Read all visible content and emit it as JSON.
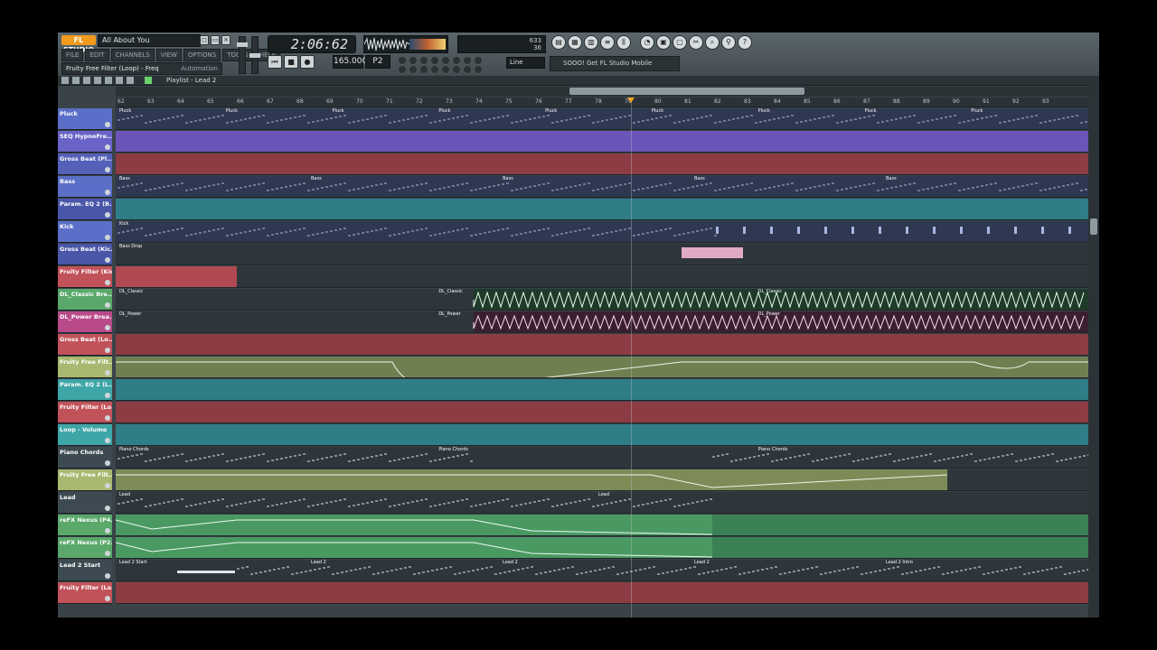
{
  "app": {
    "logo": "FL STUDIO",
    "song_title": "All About You",
    "win_buttons": [
      "◻",
      "▭",
      "×"
    ]
  },
  "menus": [
    "FILE",
    "EDIT",
    "CHANNELS",
    "VIEW",
    "OPTIONS",
    "TOOLS",
    "HELP"
  ],
  "hint": {
    "left": "Fruity Free Filter (Loop) - Freq",
    "right": "Automation"
  },
  "transport": {
    "time": "2:06:62",
    "tempo": "165.000",
    "pattern": "P2",
    "buttons": [
      "⏮",
      "■",
      "●"
    ]
  },
  "cpu": {
    "lines": [
      "633",
      "36"
    ],
    "line_mode": "Line"
  },
  "news": "SOOO! Get FL Studio Mobile",
  "playlist": {
    "title": "Playlist - Lead 2"
  },
  "ruler": [
    "62",
    "63",
    "64",
    "65",
    "66",
    "67",
    "68",
    "69",
    "70",
    "71",
    "72",
    "73",
    "74",
    "75",
    "76",
    "77",
    "78",
    "79",
    "80",
    "81",
    "82",
    "83",
    "84",
    "85",
    "86",
    "87",
    "88",
    "89",
    "90",
    "91",
    "92",
    "93"
  ],
  "tracks": [
    {
      "name": "Pluck",
      "color": "#5a6fc7",
      "lane": "notes",
      "clips": [
        "Pluck",
        "Pluck",
        "Pluck",
        "Pluck",
        "Pluck",
        "Pluck",
        "Pluck",
        "Pluck",
        "Pluck"
      ]
    },
    {
      "name": "SEQ HypnoFre...",
      "color": "#6a63c7",
      "lane": "purple",
      "clips": []
    },
    {
      "name": "Gross Beat (Pl...",
      "color": "#5560b8",
      "lane": "red",
      "clips": []
    },
    {
      "name": "Bass",
      "color": "#5a6fc7",
      "lane": "notes",
      "clips": [
        "Bass",
        "Bass",
        "Bass",
        "Bass",
        "Bass"
      ]
    },
    {
      "name": "Param. EQ 2 (B...",
      "color": "#4a56a8",
      "lane": "teal",
      "clips": []
    },
    {
      "name": "Kick",
      "color": "#5a6fc7",
      "lane": "kick",
      "clips": [
        "Kick"
      ]
    },
    {
      "name": "Gross Beat (Kic...",
      "color": "#4a56a8",
      "lane": "pink",
      "clips": [
        "Bass Drop"
      ]
    },
    {
      "name": "Fruity Filter (Kic...",
      "color": "#c2525a",
      "lane": "red-short",
      "clips": []
    },
    {
      "name": "DL_Classic Bre...",
      "color": "#5aa86a",
      "lane": "wave-green",
      "clips": [
        "DL_Classic",
        "DL_Classic",
        "DL_Classic"
      ]
    },
    {
      "name": "DL_Power Brea...",
      "color": "#b84a8a",
      "lane": "wave-pink",
      "clips": [
        "DL_Power",
        "DL_Power",
        "DL_Power"
      ]
    },
    {
      "name": "Gross Beat (Lo...",
      "color": "#c2525a",
      "lane": "red",
      "clips": []
    },
    {
      "name": "Fruity Free Filt...",
      "color": "#a8b870",
      "lane": "auto-green",
      "clips": []
    },
    {
      "name": "Param. EQ 2 (L...",
      "color": "#3fa6a8",
      "lane": "teal",
      "clips": []
    },
    {
      "name": "Fruity Filter (Lo...",
      "color": "#c2525a",
      "lane": "red",
      "clips": []
    },
    {
      "name": "Loop - Volume",
      "color": "#3fa6a8",
      "lane": "teal",
      "clips": []
    },
    {
      "name": "Piano Chords",
      "color": "#3d4a52",
      "lane": "chords",
      "clips": [
        "Piano Chords",
        "Piano Chords",
        "Piano Chords"
      ]
    },
    {
      "name": "Fruity Free Filt...",
      "color": "#a8b870",
      "lane": "auto-green2",
      "clips": []
    },
    {
      "name": "Lead",
      "color": "#3d4a52",
      "lane": "lead",
      "clips": [
        "Lead",
        "Lead"
      ]
    },
    {
      "name": "reFX Nexus (P4...",
      "color": "#5aa86a",
      "lane": "nexus",
      "clips": []
    },
    {
      "name": "reFX Nexus (P2...",
      "color": "#5aa86a",
      "lane": "nexus",
      "clips": []
    },
    {
      "name": "Lead 2 Start",
      "color": "#3d4a52",
      "lane": "lead2",
      "clips": [
        "Lead 2 Start",
        "Lead 2",
        "Lead 2",
        "Lead 2",
        "Lead 2 Intro"
      ]
    },
    {
      "name": "Fruity Filter (Lo...",
      "color": "#c2525a",
      "lane": "red",
      "clips": []
    }
  ]
}
